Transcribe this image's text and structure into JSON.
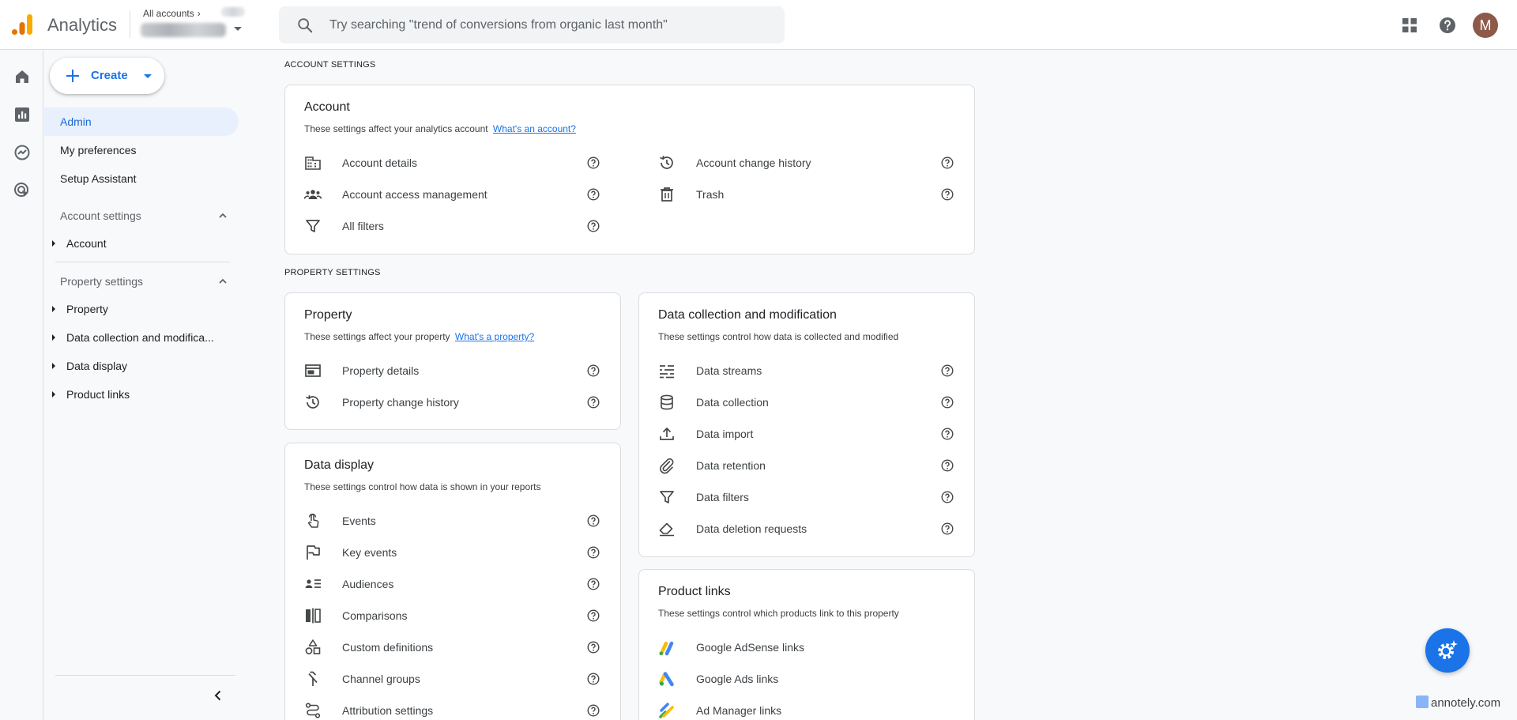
{
  "app": {
    "title": "Analytics"
  },
  "account_switcher": {
    "crumb": "All accounts",
    "chevron": "›"
  },
  "search": {
    "placeholder": "Try searching \"trend of conversions from organic last month\""
  },
  "user": {
    "avatar_letter": "M"
  },
  "colors": {
    "accent": "#1a73e8",
    "active_bg": "#e8f0fe",
    "avatar": "#8d5a4a",
    "ga_orange": "#f9ab00",
    "ga_dark_orange": "#e37400"
  },
  "nav": {
    "create_label": "Create",
    "items": [
      {
        "label": "Admin"
      },
      {
        "label": "My preferences"
      },
      {
        "label": "Setup Assistant"
      }
    ],
    "account_settings": {
      "title": "Account settings",
      "items": [
        {
          "label": "Account"
        }
      ]
    },
    "property_settings": {
      "title": "Property settings",
      "items": [
        {
          "label": "Property"
        },
        {
          "label": "Data collection and modifica..."
        },
        {
          "label": "Data display"
        },
        {
          "label": "Product links"
        }
      ]
    }
  },
  "main": {
    "account_section_title": "ACCOUNT SETTINGS",
    "property_section_title": "PROPERTY SETTINGS",
    "account_card": {
      "title": "Account",
      "desc": "These settings affect your analytics account",
      "link": "What's an account?",
      "rows_left": [
        {
          "label": "Account details",
          "icon": "building-icon"
        },
        {
          "label": "Account access management",
          "icon": "people-icon"
        },
        {
          "label": "All filters",
          "icon": "filter-icon"
        }
      ],
      "rows_right": [
        {
          "label": "Account change history",
          "icon": "history-icon"
        },
        {
          "label": "Trash",
          "icon": "trash-icon"
        }
      ]
    },
    "property_card": {
      "title": "Property",
      "desc": "These settings affect your property",
      "link": "What's a property?",
      "rows": [
        {
          "label": "Property details",
          "icon": "browser-window-icon"
        },
        {
          "label": "Property change history",
          "icon": "history-icon"
        }
      ]
    },
    "data_collection_card": {
      "title": "Data collection and modification",
      "desc": "These settings control how data is collected and modified",
      "rows": [
        {
          "label": "Data streams",
          "icon": "streams-icon"
        },
        {
          "label": "Data collection",
          "icon": "database-icon"
        },
        {
          "label": "Data import",
          "icon": "upload-icon"
        },
        {
          "label": "Data retention",
          "icon": "paperclip-icon"
        },
        {
          "label": "Data filters",
          "icon": "filter-icon"
        },
        {
          "label": "Data deletion requests",
          "icon": "eraser-icon"
        }
      ]
    },
    "data_display_card": {
      "title": "Data display",
      "desc": "These settings control how data is shown in your reports",
      "rows": [
        {
          "label": "Events",
          "icon": "touch-icon"
        },
        {
          "label": "Key events",
          "icon": "flag-icon"
        },
        {
          "label": "Audiences",
          "icon": "audience-list-icon"
        },
        {
          "label": "Comparisons",
          "icon": "compare-icon"
        },
        {
          "label": "Custom definitions",
          "icon": "shapes-icon"
        },
        {
          "label": "Channel groups",
          "icon": "merge-icon"
        },
        {
          "label": "Attribution settings",
          "icon": "route-icon"
        }
      ]
    },
    "product_links_card": {
      "title": "Product links",
      "desc": "These settings control which products link to this property",
      "rows": [
        {
          "label": "Google AdSense links",
          "icon": "adsense-icon"
        },
        {
          "label": "Google Ads links",
          "icon": "google-ads-icon"
        },
        {
          "label": "Ad Manager links",
          "icon": "ad-manager-icon"
        }
      ]
    }
  },
  "watermark": {
    "text": "annotely.com"
  }
}
